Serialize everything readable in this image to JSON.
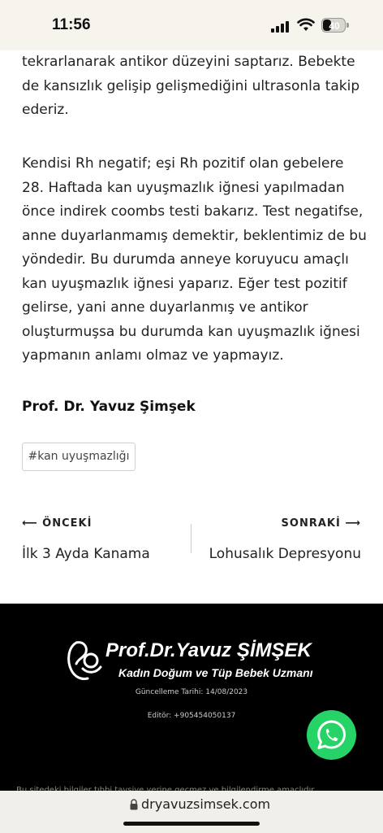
{
  "status": {
    "time": "11:56",
    "battery": "40",
    "battery_level": 0.4
  },
  "article": {
    "paragraph_1": "tekrarlanarak antikor düzeyini saptarız. Bebekte de kansızlık gelişip gelişmediğini ultrasonla takip ederiz.",
    "paragraph_2": "Kendisi Rh negatif; eşi Rh pozitif olan gebelere 28. Haftada kan uyuşmazlık iğnesi yapılmadan önce indirek coombs testi bakarız. Test negatifse, anne duyarlanmamış demektir, beklentimiz de bu yöndedir. Bu durumda anneye koruyucu amaçlı kan uyuşmazlık iğnesi yaparız. Eğer test pozitif gelirse, yani anne duyarlanmış ve antikor oluşturmuşsa bu durumda kan uyuşmazlık iğnesi yapmanın anlamı olmaz ve yapmayız.",
    "author": "Prof. Dr. Yavuz Şimşek",
    "tag": "#kan uyuşmazlığı"
  },
  "post_nav": {
    "prev_label": "⟵ ÖNCEKİ",
    "prev_title": "İlk 3 Ayda Kanama",
    "next_label": "SONRAKİ ⟶",
    "next_title": "Lohusalık Depresyonu"
  },
  "footer": {
    "logo_name": "Prof.Dr.Yavuz ŞİMŞEK",
    "logo_subtitle": "Kadın Doğum ve Tüp Bebek Uzmanı",
    "updated": "Güncelleme Tarihi: 14/08/2023",
    "editor": "Editör: +905454050137",
    "cut_text": "Bu sitedeki bilgiler tıbbi tavsiye yerine geçmez ve bilgilendirme amaçlıdır"
  },
  "browser": {
    "url": "dryavuzsimsek.com"
  },
  "colors": {
    "whatsapp": "#25d366",
    "footer_bg": "#000000"
  }
}
